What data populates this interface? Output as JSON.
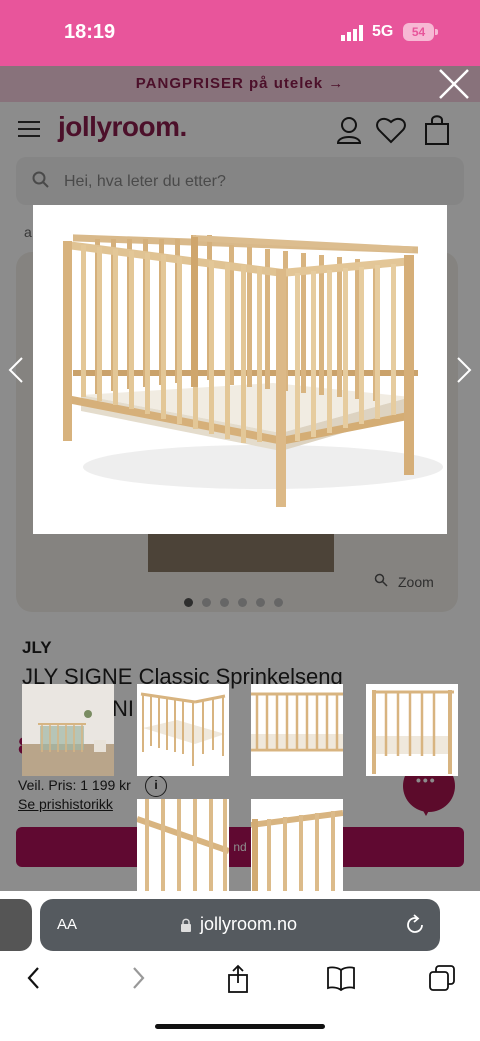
{
  "status": {
    "time": "18:19",
    "network": "5G",
    "battery": "54"
  },
  "promo": {
    "text": "PANGPRISER på utelek →"
  },
  "header": {
    "logo": "jollyroom.",
    "search_placeholder": "Hei, hva leter du etter?"
  },
  "product": {
    "breadcrumb_fragment": "a",
    "zoom_label": "Zoom",
    "brand": "JLY",
    "title": "JLY SIGNE Classic Sprinkelseng",
    "title_line2": "NI",
    "price_fragment": "8",
    "regular_price": "Veil. Pris: 1 199 kr",
    "price_history": "Se prishistorikk",
    "cart_button_fragment": "nd"
  },
  "gallery": {
    "dot_count": 6,
    "active_dot": 0,
    "thumbnail_count": 6
  },
  "browser": {
    "aa_label": "AA",
    "url": "jollyroom.no"
  },
  "colors": {
    "status_bar": "#e8559b",
    "brand": "#8b1e4e",
    "accent": "#b0125a"
  }
}
